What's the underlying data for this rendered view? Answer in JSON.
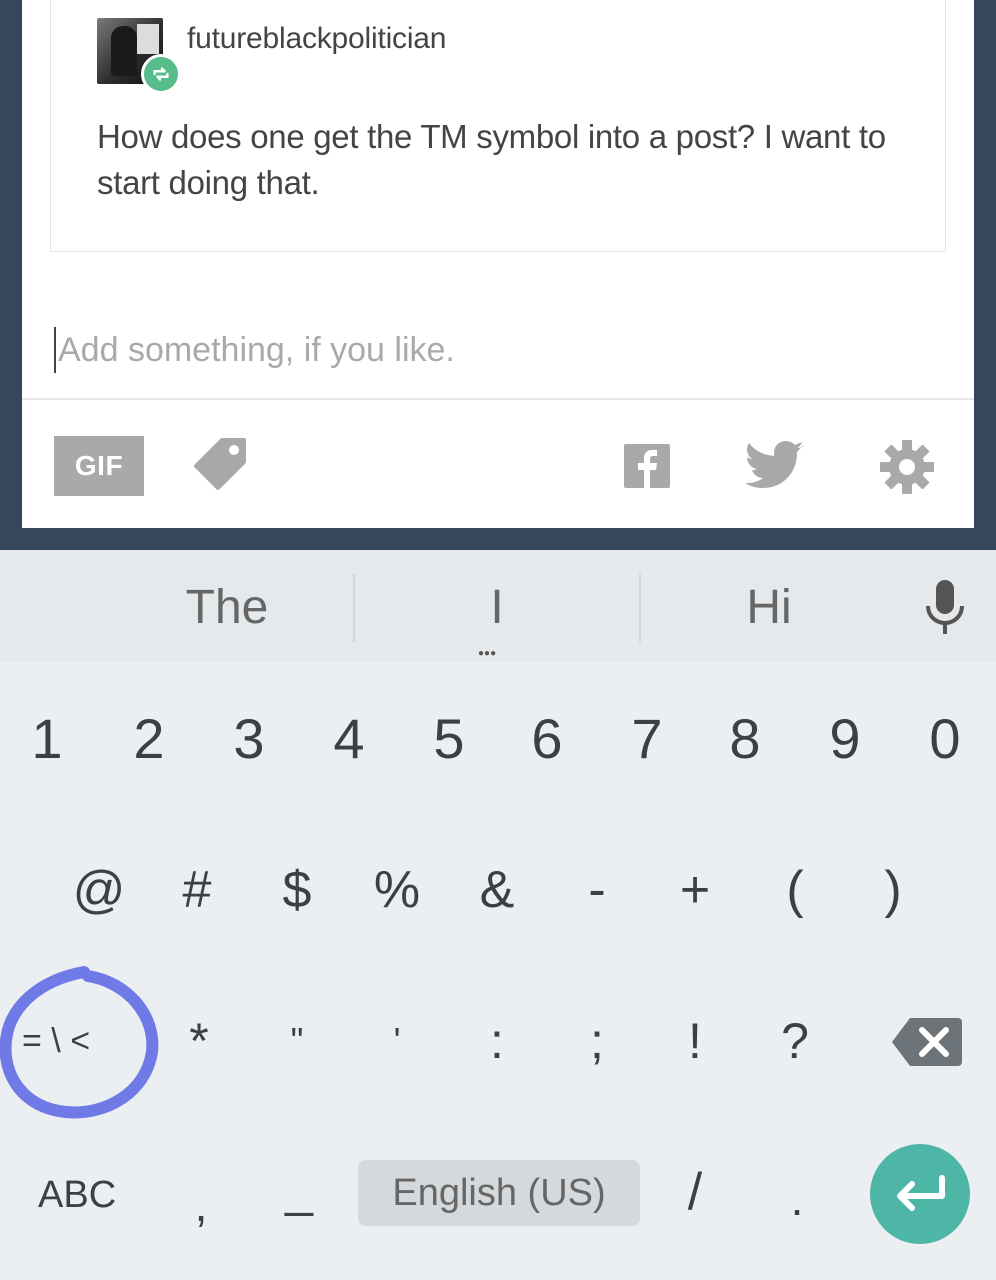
{
  "post": {
    "username": "futureblackpolitician",
    "text": "How does one get the TM symbol into a post? I want to start doing that.",
    "reblog_icon": "reblog-icon",
    "avatar_icon": "avatar"
  },
  "composer": {
    "placeholder": "Add something, if you like.",
    "value": ""
  },
  "toolbar": {
    "gif_label": "GIF",
    "tag_icon": "tag-icon",
    "facebook_icon": "facebook-icon",
    "twitter_icon": "twitter-icon",
    "settings_icon": "gear-icon"
  },
  "keyboard": {
    "suggestions": [
      "The",
      "I",
      "Hi"
    ],
    "mic_icon": "microphone-icon",
    "number_row": [
      "1",
      "2",
      "3",
      "4",
      "5",
      "6",
      "7",
      "8",
      "9",
      "0"
    ],
    "symbol_row_1": [
      "@",
      "#",
      "$",
      "%",
      "&",
      "-",
      "+",
      "(",
      ")"
    ],
    "more_symbols_label": "= \\ <",
    "symbol_row_2": [
      "*",
      "\"",
      "'",
      ":",
      ";",
      "!",
      "?"
    ],
    "backspace_icon": "backspace-icon",
    "abc_label": "ABC",
    "bottom_keys": [
      ",",
      "_",
      "/",
      "."
    ],
    "space_label": "English (US)",
    "enter_icon": "enter-icon",
    "highlight_color": "#6f7ae6",
    "enter_color": "#4db6a6"
  }
}
